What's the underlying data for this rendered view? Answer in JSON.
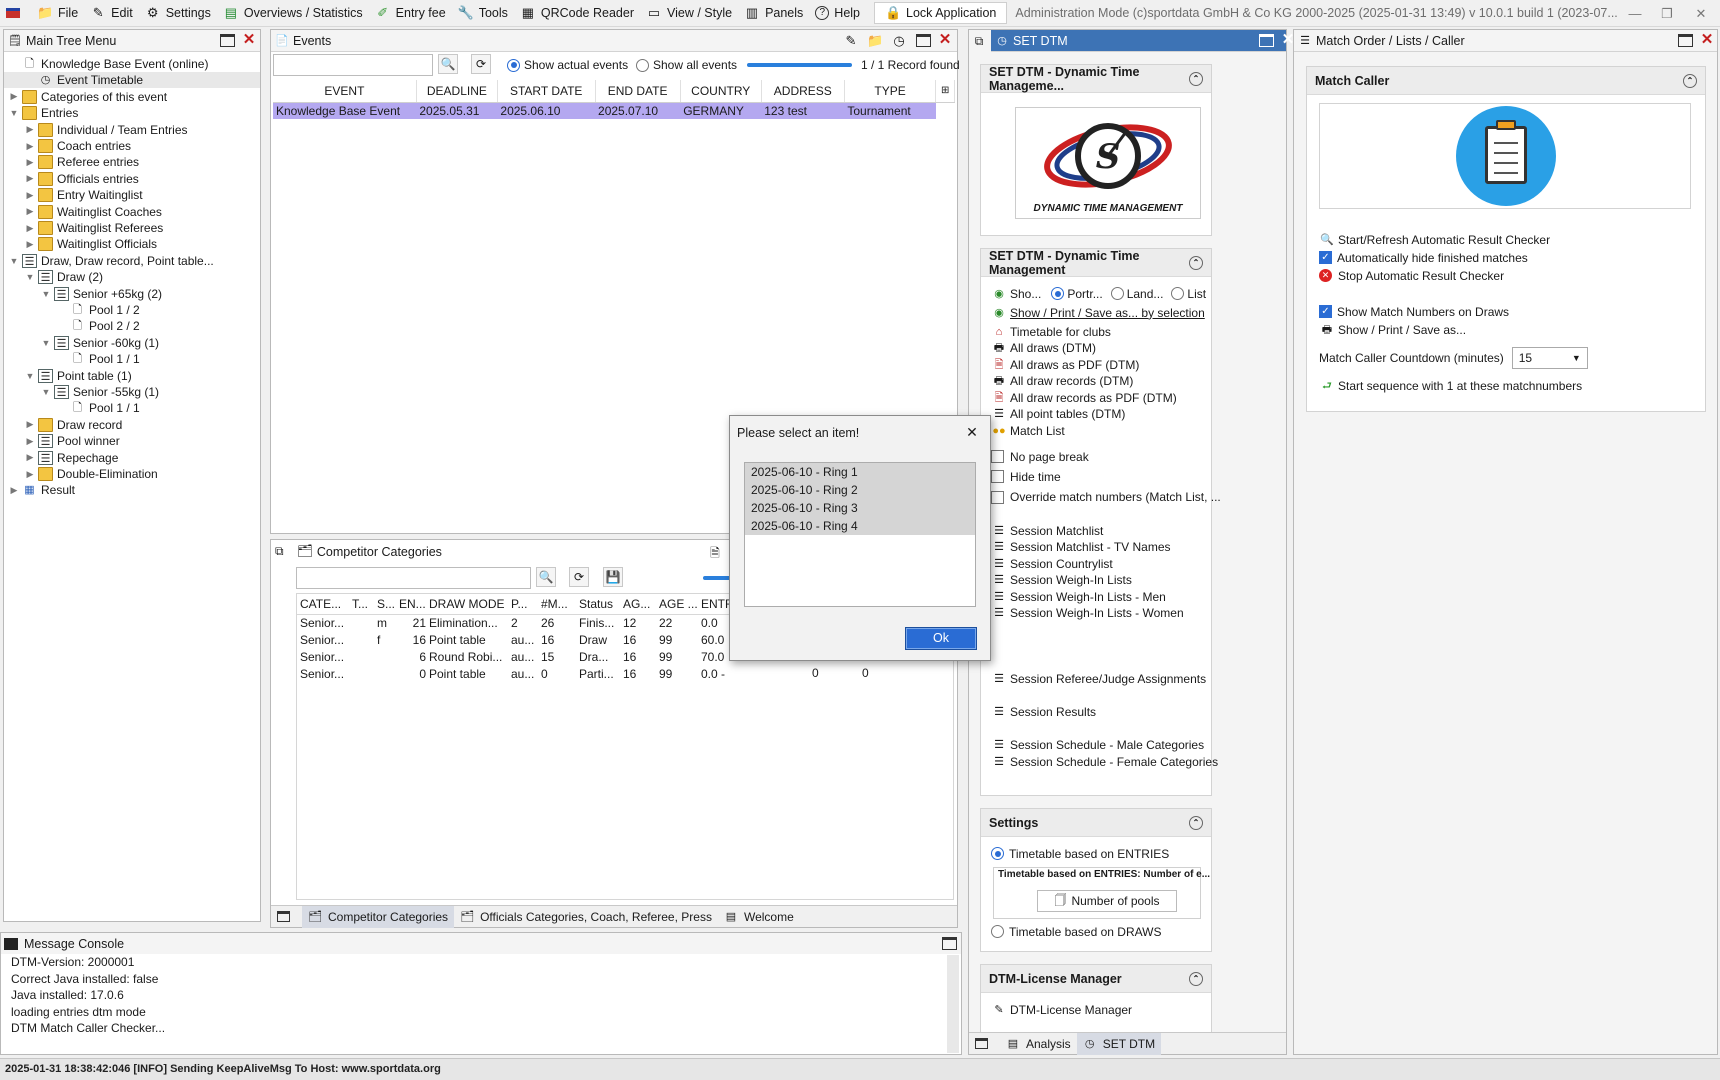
{
  "menubar": {
    "items": [
      "File",
      "Edit",
      "Settings",
      "Overviews / Statistics",
      "Entry fee",
      "Tools",
      "QRCode Reader",
      "View / Style",
      "Panels",
      "Help"
    ],
    "lock": "Lock Application",
    "admin_info": "Administration Mode (c)sportdata GmbH & Co KG 2000-2025 (2025-01-31 13:49)  v 10.0.1 build 1 (2023-07..."
  },
  "tree": {
    "title": "Main Tree Menu",
    "items": [
      "Knowledge Base Event (online)",
      "Event Timetable",
      "Categories of this event",
      "Entries",
      "Individual / Team Entries",
      "Coach entries",
      "Referee entries",
      "Officials entries",
      "Entry Waitinglist",
      "Waitinglist Coaches",
      "Waitinglist Referees",
      "Waitinglist Officials",
      "Draw, Draw record, Point table...",
      "Draw (2)",
      "Senior +65kg (2)",
      "Pool 1 / 2",
      "Pool 2 / 2",
      "Senior -60kg (1)",
      "Pool 1 / 1",
      "Point table (1)",
      "Senior -55kg (1)",
      "Pool 1 / 1",
      "Draw record",
      "Pool winner",
      "Repechage",
      "Double-Elimination",
      "Result"
    ]
  },
  "events": {
    "title": "Events",
    "show_actual": "Show actual events",
    "show_all": "Show all events",
    "record_info": "1 / 1 Record found",
    "columns": [
      "EVENT",
      "DEADLINE",
      "START DATE",
      "END DATE",
      "COUNTRY",
      "ADDRESS",
      "TYPE"
    ],
    "rows": [
      [
        "Knowledge Base Event",
        "2025.05.31",
        "2025.06.10",
        "2025.07.10",
        "GERMANY",
        "123 test",
        "Tournament"
      ]
    ]
  },
  "competitor": {
    "title": "Competitor Categories",
    "columns": [
      "CATE...",
      "T...",
      "S...",
      "EN...",
      "DRAW MODE",
      "P...",
      "#M...",
      "Status",
      "AG...",
      "AGE ...",
      "ENTR..."
    ],
    "rows": [
      [
        "Senior...",
        "",
        "m",
        "21",
        "Elimination...",
        "2",
        "26",
        "Finis...",
        "12",
        "22",
        "0.0"
      ],
      [
        "Senior...",
        "",
        "f",
        "16",
        "Point table",
        "au...",
        "16",
        "Draw",
        "16",
        "99",
        "60.0"
      ],
      [
        "Senior...",
        "",
        "",
        "6",
        "Round Robi...",
        "au...",
        "15",
        "Dra...",
        "16",
        "99",
        "70.0"
      ],
      [
        "Senior...",
        "",
        "",
        "0",
        "Point table",
        "au...",
        "0",
        "Parti...",
        "16",
        "99",
        "0.0 -"
      ]
    ],
    "extra_row3": [
      "0",
      "0"
    ],
    "extra_row4": [
      "0",
      "0"
    ],
    "tabs": [
      "Competitor Categories",
      "Officials Categories, Coach, Referee, Press",
      "Welcome"
    ]
  },
  "dialog": {
    "title": "Please select an item!",
    "items": [
      "2025-06-10 - Ring 1",
      "2025-06-10 - Ring 2",
      "2025-06-10 - Ring 3",
      "2025-06-10 - Ring 4"
    ],
    "ok": "Ok"
  },
  "setdtm": {
    "title": "SET DTM",
    "sec1_title": "SET DTM - Dynamic Time Manageme...",
    "logo_text": "DYNAMIC TIME MANAGEMENT",
    "sec2_title": "SET DTM - Dynamic Time Management",
    "show_label": "Sho...",
    "portrait": "Portr...",
    "landscape": "Land...",
    "list": "List",
    "show_print": "Show / Print / Save as... by selection",
    "links": [
      "Timetable for clubs",
      "All draws (DTM)",
      "All draws as PDF (DTM)",
      "All draw records (DTM)",
      "All draw records as PDF (DTM)",
      "All point tables (DTM)",
      "Match List"
    ],
    "checks": [
      "No page break",
      "Hide time",
      "Override match numbers (Match List, ..."
    ],
    "sessions": [
      "Session Matchlist",
      "Session Matchlist - TV Names",
      "Session Countrylist",
      "Session Weigh-In Lists",
      "Session Weigh-In Lists - Men",
      "Session Weigh-In Lists - Women"
    ],
    "session_ref": "Session Referee/Judge Assignments",
    "session_results": "Session Results",
    "sched_male": "Session Schedule - Male Categories",
    "sched_female": "Session Schedule - Female Categories",
    "settings_title": "Settings",
    "tt_entries": "Timetable based on ENTRIES",
    "tt_entries_group": "Timetable based on ENTRIES: Number of e...",
    "num_pools": "Number of pools",
    "tt_draws": "Timetable based on DRAWS",
    "license_title": "DTM-License Manager",
    "license_link": "DTM-License Manager",
    "tabs": [
      "Analysis",
      "SET DTM"
    ]
  },
  "matchcaller": {
    "panel_title": "Match Order / Lists / Caller",
    "section_title": "Match Caller",
    "start_refresh": "Start/Refresh Automatic Result Checker",
    "auto_hide": "Automatically hide finished matches",
    "stop": "Stop Automatic Result Checker",
    "show_numbers": "Show Match Numbers on Draws",
    "show_print": "Show / Print / Save as...",
    "countdown_label": "Match Caller Countdown (minutes)",
    "countdown_value": "15",
    "start_sequence": "Start sequence with 1 at these matchnumbers"
  },
  "console": {
    "title": "Message Console",
    "lines": [
      "DTM-Version: 2000001",
      "Correct Java installed: false",
      "Java installed: 17.0.6",
      "loading entries dtm mode",
      "DTM Match Caller Checker..."
    ]
  },
  "status": "2025-01-31 18:38:42:046 [INFO] Sending KeepAliveMsg To Host: www.sportdata.org",
  "colors": {
    "accent": "#2a6cd4",
    "selection": "#b4a8f0",
    "title_blue": "#3d73b5"
  }
}
